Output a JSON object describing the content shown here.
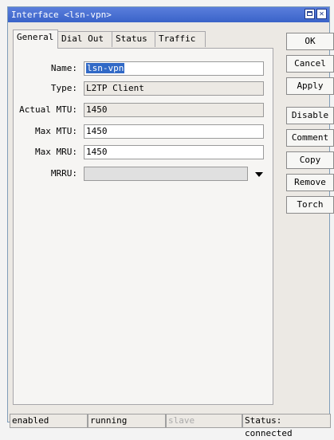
{
  "window": {
    "title": "Interface <lsn-vpn>"
  },
  "tabs": [
    {
      "label": "General"
    },
    {
      "label": "Dial Out"
    },
    {
      "label": "Status"
    },
    {
      "label": "Traffic"
    }
  ],
  "form": {
    "name": {
      "label": "Name:",
      "value": "lsn-vpn"
    },
    "type": {
      "label": "Type:",
      "value": "L2TP Client"
    },
    "actual_mtu": {
      "label": "Actual MTU:",
      "value": "1450"
    },
    "max_mtu": {
      "label": "Max MTU:",
      "value": "1450"
    },
    "max_mru": {
      "label": "Max MRU:",
      "value": "1450"
    },
    "mrru": {
      "label": "MRRU:",
      "value": ""
    }
  },
  "buttons": {
    "ok": "OK",
    "cancel": "Cancel",
    "apply": "Apply",
    "disable": "Disable",
    "comment": "Comment",
    "copy": "Copy",
    "remove": "Remove",
    "torch": "Torch"
  },
  "status_bar": {
    "state": "enabled",
    "running": "running",
    "slave": "slave",
    "status": "Status: connected"
  }
}
